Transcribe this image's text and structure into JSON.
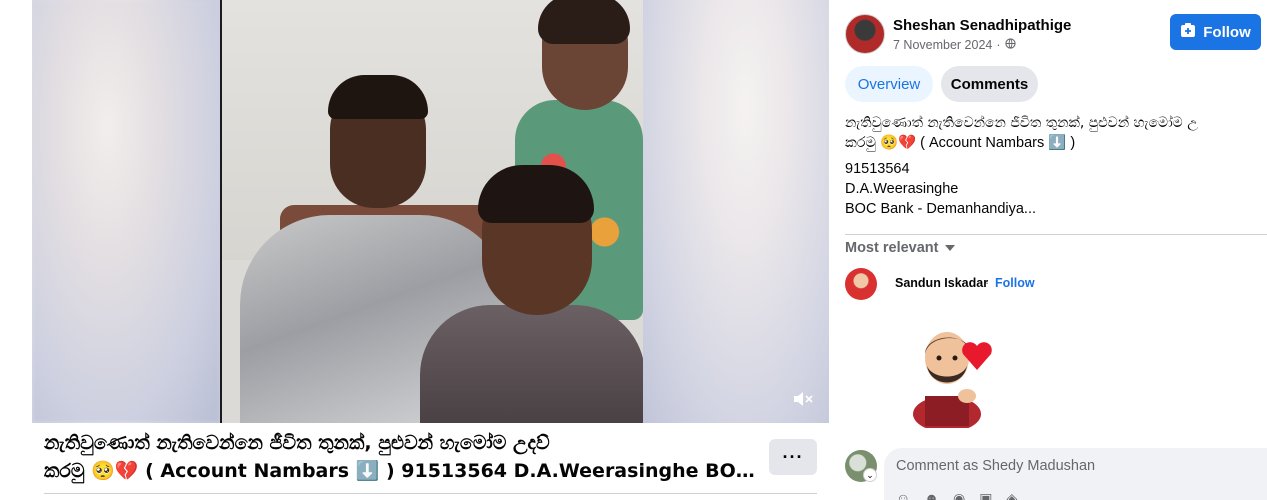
{
  "post": {
    "caption_line1": "නැතිවුණොත් නැතිවෙන්නෙ ජීවිත තුනක්, පුළුවන් හැමෝම උදව්",
    "caption_line2": "කරමු 🥺💔 ( Account Nambars ⬇️ ) 91513564 D.A.Weerasinghe BOC...",
    "more_label": "···"
  },
  "author": {
    "name": "Sheshan Senadhipathige",
    "date": "7 November 2024",
    "separator": "·",
    "privacy_icon": "globe-icon",
    "follow_label": "Follow"
  },
  "tabs": [
    {
      "label": "Overview",
      "selected": false
    },
    {
      "label": "Comments",
      "selected": true
    }
  ],
  "description": {
    "line1": "නැතිවුණොත් නැතිවෙන්නෙ ජීවිත තුනක්, පුළුවන් හැමෝම උ",
    "line2": "කරමු 🥺💔 ( Account Nambars ⬇️ )",
    "account_number": "91513564",
    "account_name": "D.A.Weerasinghe",
    "bank": "BOC Bank - Demanhandiya..."
  },
  "comments_section": {
    "sort_label": "Most relevant",
    "comment": {
      "author": "Sandun Iskadar",
      "dot": "·",
      "follow_label": "Follow"
    },
    "input_placeholder": "Comment as Shedy Madushan"
  },
  "colors": {
    "accent": "#1b74e4",
    "tab_selected_bg": "#e4e6eb",
    "tab_overview_bg": "#ebf5ff",
    "muted_text": "#65676b"
  }
}
